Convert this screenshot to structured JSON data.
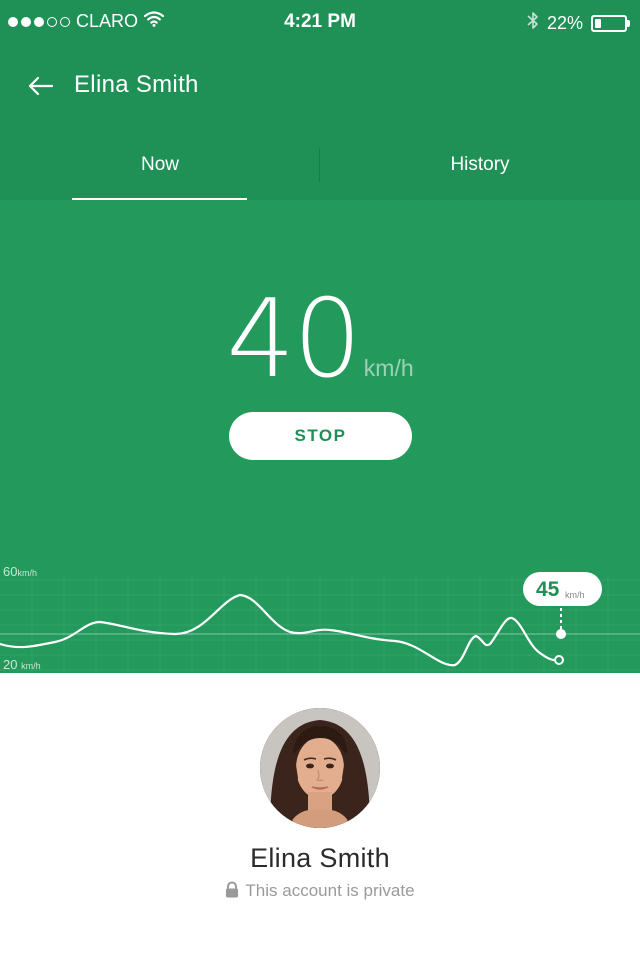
{
  "status_bar": {
    "carrier": "CLARO",
    "time": "4:21 PM",
    "battery_percent": "22%",
    "battery_level": 0.22,
    "signal_bars_filled": 3,
    "signal_bars_total": 5,
    "icons": [
      "wifi-icon",
      "bluetooth-icon",
      "battery-icon"
    ]
  },
  "app_bar": {
    "title": "Elina Smith",
    "back_icon": "arrow-left-icon"
  },
  "tabs": [
    {
      "label": "Now",
      "active": true
    },
    {
      "label": "History",
      "active": false
    }
  ],
  "speed": {
    "value": "40",
    "unit": "km/h"
  },
  "stop_button": {
    "label": "STOP"
  },
  "speed_chart": {
    "axis_top_value": "60",
    "axis_top_unit": "km/h",
    "axis_bottom_value": "20",
    "axis_bottom_unit": "km/h",
    "current_value": "45",
    "current_unit": "km/h"
  },
  "profile": {
    "name": "Elina Smith",
    "privacy_text": "This account is private",
    "lock_icon": "lock-icon"
  },
  "colors": {
    "header_green": "#1f9157",
    "main_green": "#239a5c",
    "accent_green": "#1f8f55",
    "white": "#ffffff"
  }
}
